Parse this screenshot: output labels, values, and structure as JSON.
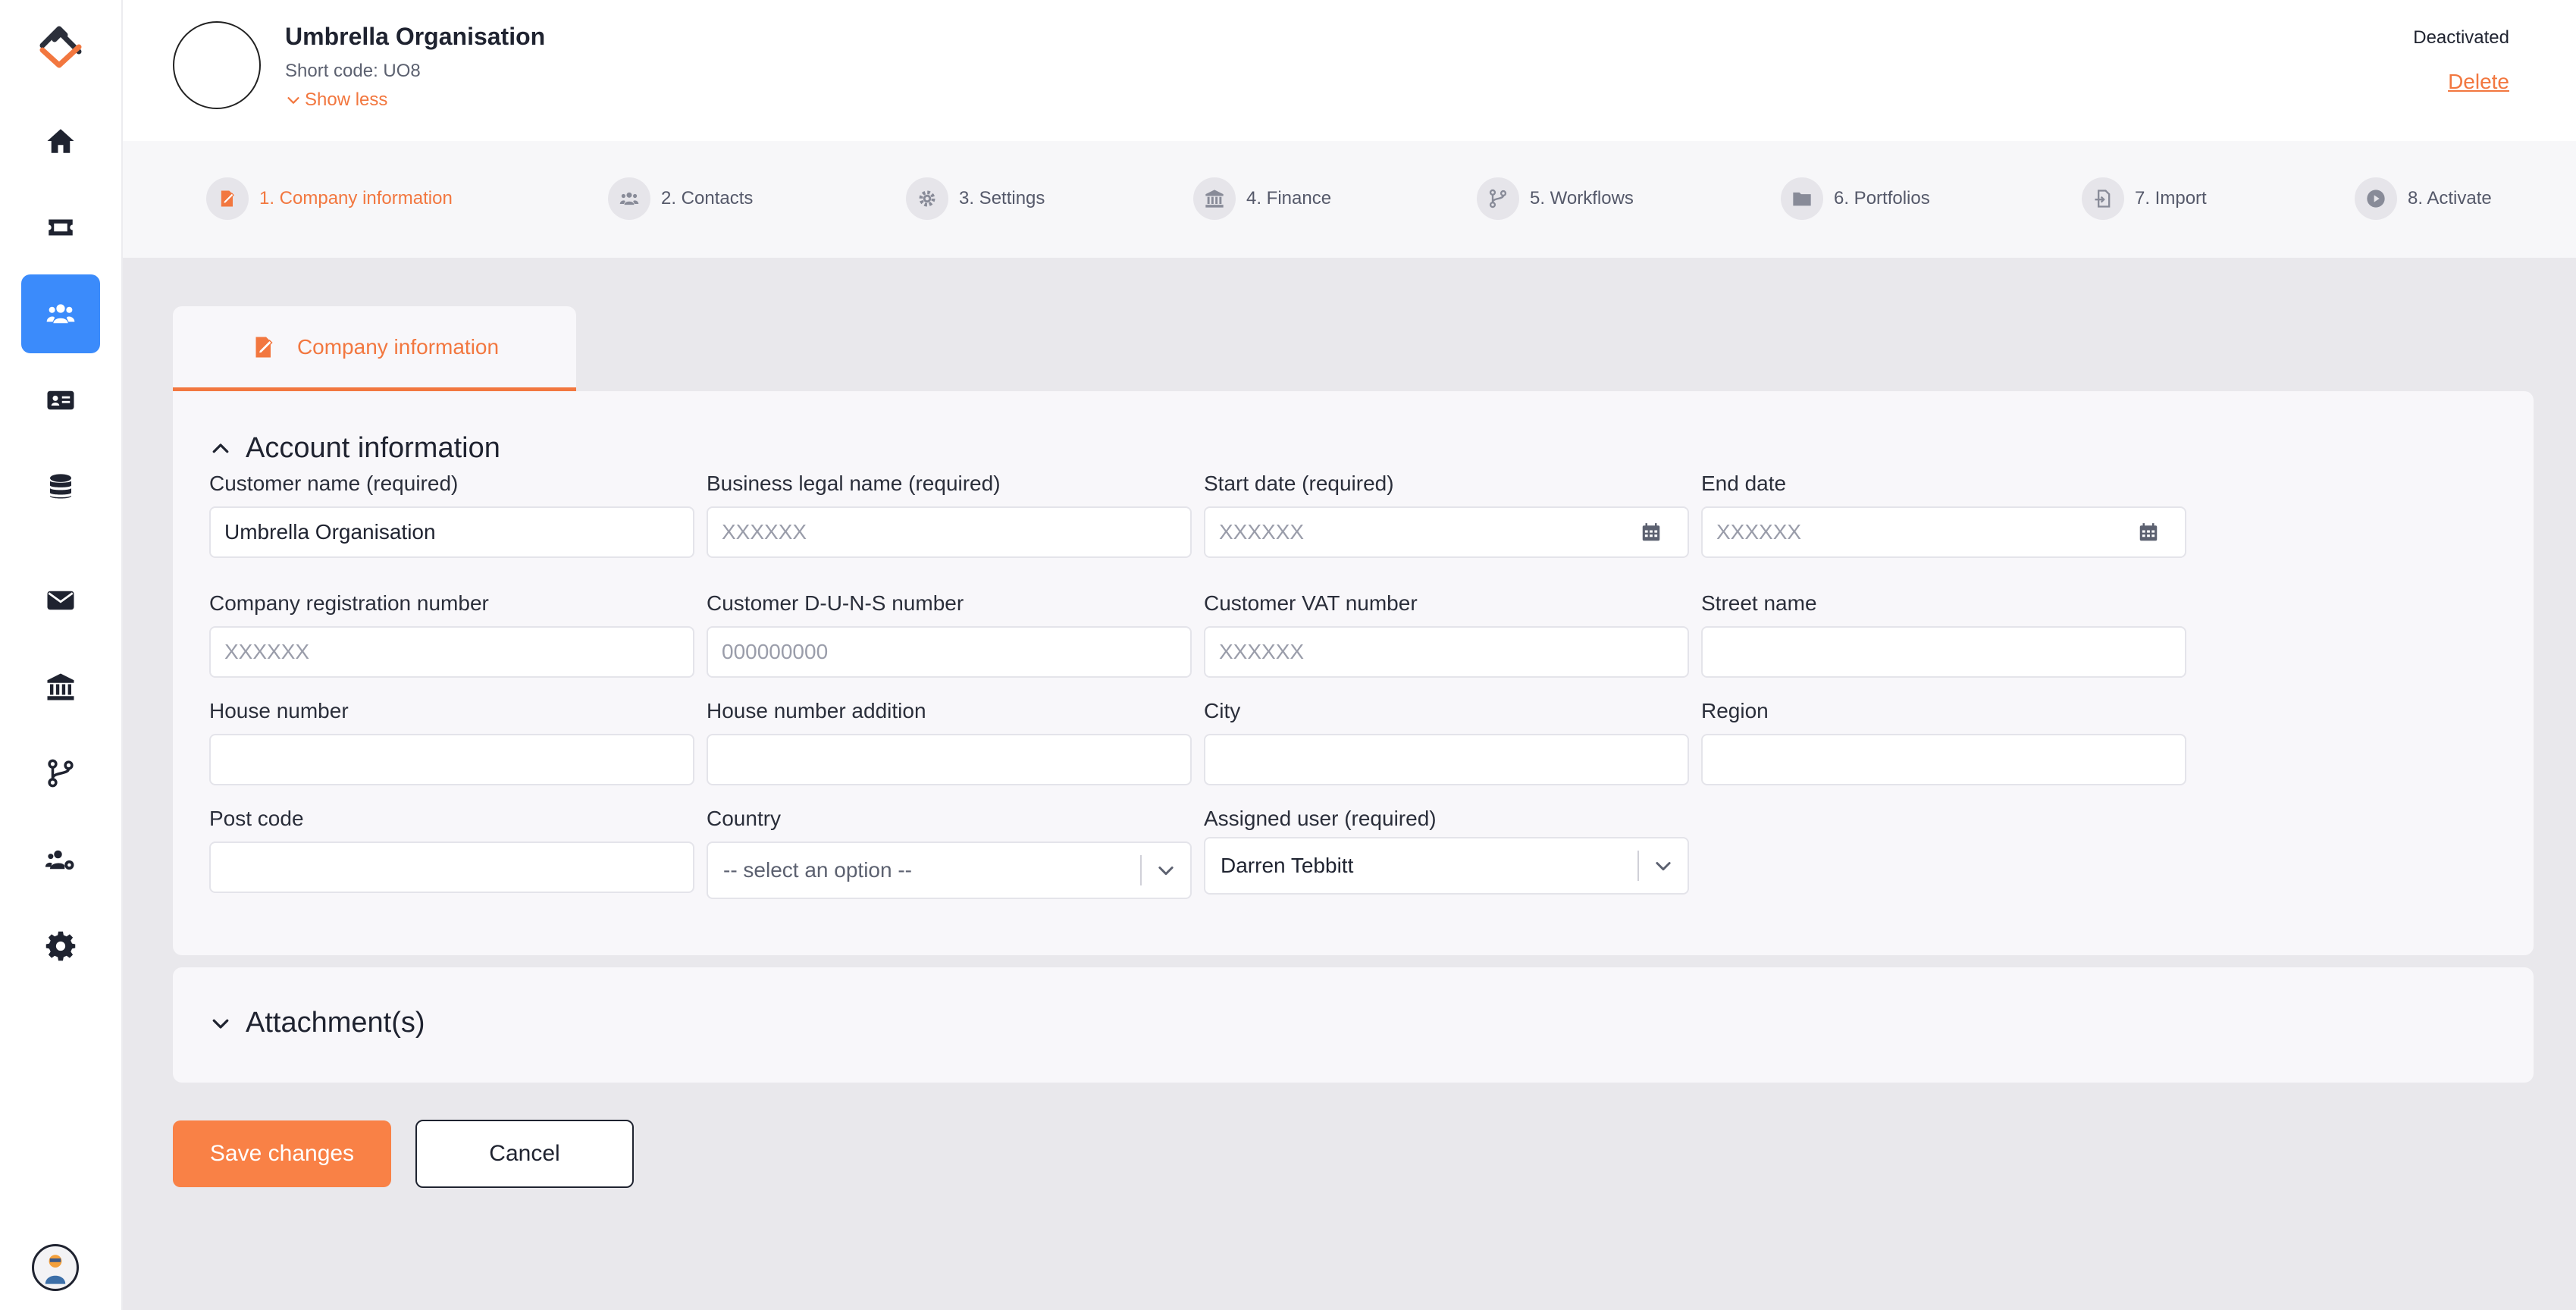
{
  "colors": {
    "accent": "#f2773f",
    "active_nav": "#3b8bfb",
    "primary_button": "#f98146"
  },
  "sidebar": {
    "items": [
      {
        "icon": "home-icon"
      },
      {
        "icon": "ticket-icon"
      },
      {
        "icon": "users-icon",
        "active": true
      },
      {
        "icon": "id-card-icon"
      },
      {
        "icon": "database-icon"
      },
      {
        "icon": "envelope-icon"
      },
      {
        "icon": "bank-icon"
      },
      {
        "icon": "code-branch-icon"
      },
      {
        "icon": "users-cog-icon"
      },
      {
        "icon": "gear-icon"
      }
    ]
  },
  "header": {
    "org_name": "Umbrella Organisation",
    "short_code": "Short code: UO8",
    "show_less": "Show less",
    "status": "Deactivated",
    "delete_label": "Delete"
  },
  "stepper": {
    "steps": [
      {
        "label": "1. Company information",
        "icon": "file-signature-icon",
        "active": true
      },
      {
        "label": "2. Contacts",
        "icon": "users-icon"
      },
      {
        "label": "3. Settings",
        "icon": "gear-icon"
      },
      {
        "label": "4. Finance",
        "icon": "bank-icon"
      },
      {
        "label": "5. Workflows",
        "icon": "code-branch-icon"
      },
      {
        "label": "6. Portfolios",
        "icon": "folder-icon"
      },
      {
        "label": "7. Import",
        "icon": "file-import-icon"
      },
      {
        "label": "8. Activate",
        "icon": "play-circle-icon"
      }
    ]
  },
  "tab": {
    "label": "Company information",
    "icon": "file-signature-icon"
  },
  "account_section": {
    "title": "Account information",
    "fields": {
      "customer_name": {
        "label": "Customer name (required)",
        "value": "Umbrella Organisation",
        "placeholder": ""
      },
      "legal_name": {
        "label": "Business legal name (required)",
        "value": "",
        "placeholder": "XXXXXX"
      },
      "start_date": {
        "label": "Start date (required)",
        "value": "",
        "placeholder": "XXXXXX"
      },
      "end_date": {
        "label": "End date",
        "value": "",
        "placeholder": "XXXXXX"
      },
      "registration": {
        "label": "Company registration number",
        "value": "",
        "placeholder": "XXXXXX"
      },
      "duns": {
        "label": "Customer D-U-N-S number",
        "value": "",
        "placeholder": "000000000"
      },
      "vat": {
        "label": "Customer VAT number",
        "value": "",
        "placeholder": "XXXXXX"
      },
      "street": {
        "label": "Street name",
        "value": "",
        "placeholder": ""
      },
      "house_number": {
        "label": "House number",
        "value": "",
        "placeholder": ""
      },
      "house_addition": {
        "label": "House number addition",
        "value": "",
        "placeholder": ""
      },
      "city": {
        "label": "City",
        "value": "",
        "placeholder": ""
      },
      "region": {
        "label": "Region",
        "value": "",
        "placeholder": ""
      },
      "post_code": {
        "label": "Post code",
        "value": "",
        "placeholder": ""
      },
      "country": {
        "label": "Country",
        "selected": "-- select an option --"
      },
      "assigned_user": {
        "label": "Assigned user (required)",
        "selected": "Darren Tebbitt"
      }
    }
  },
  "attachments_section": {
    "title": "Attachment(s)"
  },
  "actions": {
    "save": "Save changes",
    "cancel": "Cancel"
  }
}
